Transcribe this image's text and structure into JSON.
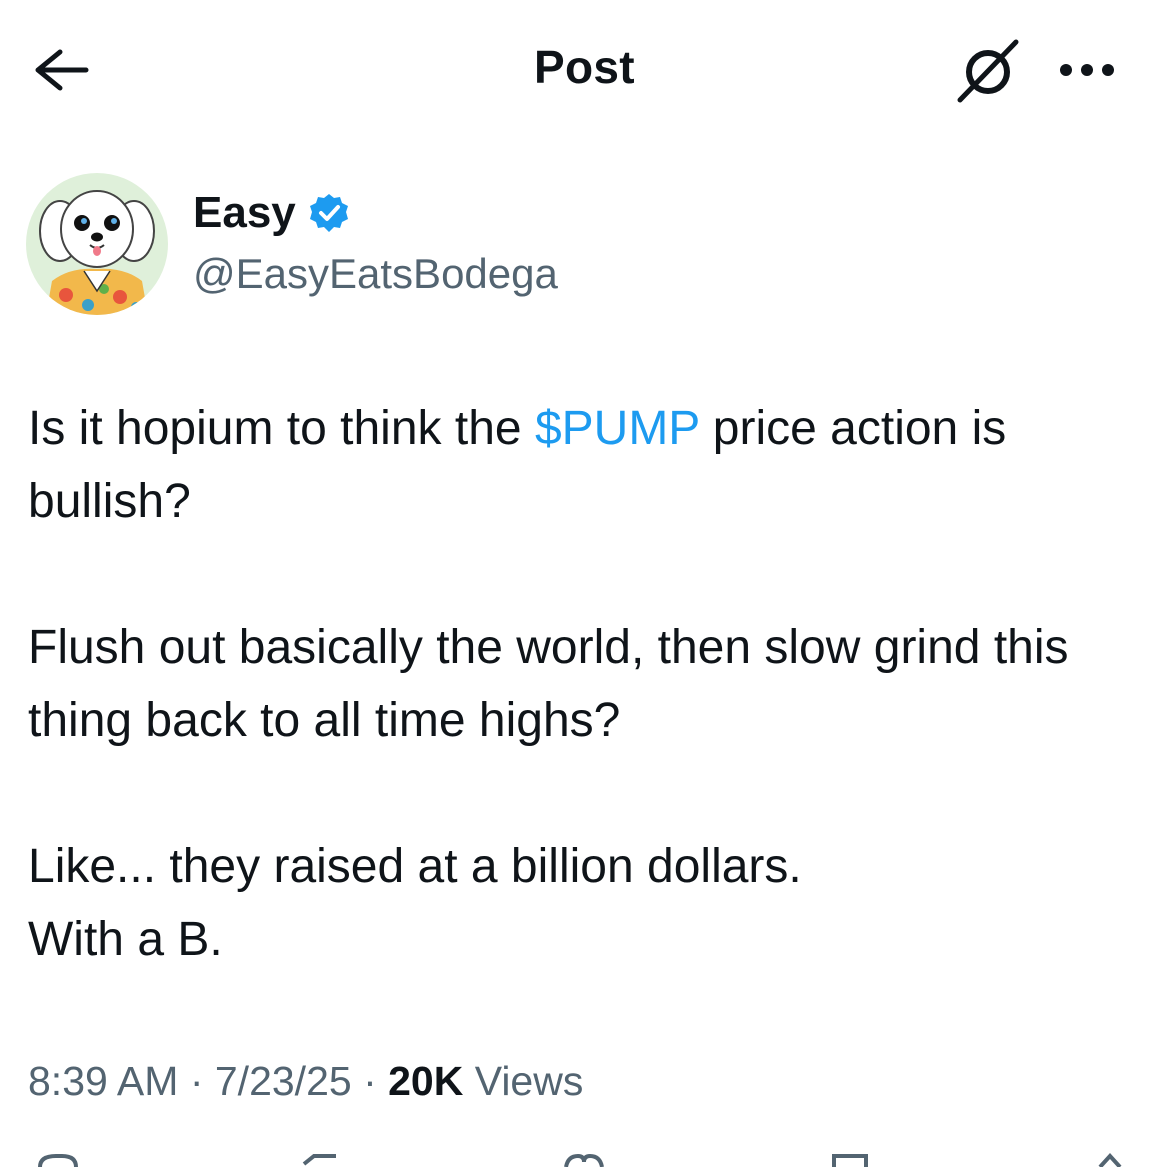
{
  "header": {
    "title": "Post",
    "back_icon": "arrow-left-icon",
    "grok_icon": "grok-slash-circle-icon",
    "more_icon": "more-horizontal-icon"
  },
  "author": {
    "display_name": "Easy",
    "handle": "@EasyEatsBodega",
    "verified": true,
    "verified_color": "#1d9bf0",
    "avatar_icon": "cartoon-dog-avatar"
  },
  "post": {
    "line1_before": "Is it hopium to think the ",
    "cashtag": "$PUMP",
    "line1_after": " price action is bullish?",
    "paragraph2": "Flush out basically the world, then slow grind this thing back to all time highs?",
    "paragraph3_line1": "Like... they raised at a billion dollars.",
    "paragraph3_line2": "With a B."
  },
  "meta": {
    "time": "8:39 AM",
    "sep1": " · ",
    "date": "7/23/25",
    "sep2": " · ",
    "views_count": "20K",
    "views_label": " Views"
  },
  "colors": {
    "text_primary": "#0f1419",
    "text_secondary": "#536471",
    "link": "#1d9bf0",
    "background": "#ffffff"
  }
}
